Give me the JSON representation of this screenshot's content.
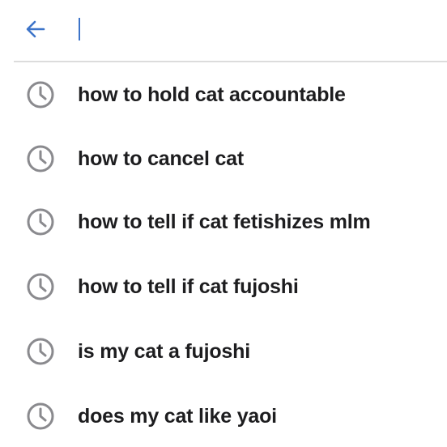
{
  "search": {
    "back_icon": "arrow-left-icon",
    "placeholder": "",
    "value": "",
    "accent_color": "#3d74c9"
  },
  "suggestions": [
    {
      "icon": "history-clock-icon",
      "label": "how to hold cat accountable"
    },
    {
      "icon": "history-clock-icon",
      "label": "how to cancel cat"
    },
    {
      "icon": "history-clock-icon",
      "label": "how to tell if cat fetishizes mlm"
    },
    {
      "icon": "history-clock-icon",
      "label": "how to tell if cat fujoshi"
    },
    {
      "icon": "history-clock-icon",
      "label": "is my cat a fujoshi"
    },
    {
      "icon": "history-clock-icon",
      "label": "does my cat like yaoi"
    }
  ]
}
